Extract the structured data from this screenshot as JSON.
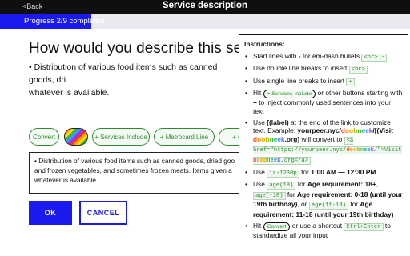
{
  "header": {
    "back_label": "<Back",
    "title": "Service description"
  },
  "progress": {
    "label": "Progress 2/9 completed",
    "fraction": 0.222
  },
  "question": {
    "title": "How would you describe this servi",
    "preview_line1": "• Distribution of various food items such as canned goods, dri",
    "preview_line2": "whatever is available."
  },
  "chips": {
    "convert": "Convert",
    "services": "+ Services Include",
    "metrocard": "+ Metrocard Line",
    "criminal": "+ Crimi"
  },
  "editor": {
    "line1": "• Distribution of various food items such as canned goods, dried goo",
    "line2": "and frozen vegetables, and sometimes frozen meats. Items given a",
    "line3": "whatever is available."
  },
  "buttons": {
    "ok": "OK",
    "cancel": "CANCEL"
  },
  "instructions": {
    "heading": "Instructions:",
    "item1_pre": "Start lines with ",
    "item1_dash": "-",
    "item1_mid": " for em-dash bullets ",
    "item1_code": "<br> -",
    "item2_pre": "Use double line breaks to insert ",
    "item2_code": "<br>",
    "item3_pre": "Use single line breaks to insert ",
    "item3_code": "•",
    "item4_pre": "Hit ",
    "item4_chip": "+ Services Include",
    "item4_mid": " or other buttons starting with ",
    "item4_plus": "+",
    "item4_post": " to inject commonly used sentences into your text",
    "item5_pre": "Use ",
    "item5_label": "[(label)",
    "item5_mid1": " at the end of the link to customize text. Example: ",
    "item5_ex1": "yourpeer.nyc/",
    "item5_ex2": "doobneek",
    "item5_ex3": "/[(Visit ",
    "item5_ex4": "doobneek",
    "item5_ex5": ".org)",
    "item5_mid2": " will convert to ",
    "item5_code1": "<a href=\"https://yourpeer.nyc/",
    "item5_code2": "doobneek",
    "item5_code3": "/\">Visit ",
    "item5_code4": "doobneek",
    "item5_code5": ".org</a>",
    "item6_pre": "Use ",
    "item6_code": "1a-1230p",
    "item6_mid": " for ",
    "item6_bold": "1:00 AM — 12:30 PM",
    "item7_pre": "Use ",
    "item7_code1": "age(18)",
    "item7_mid1": " for ",
    "item7_bold1": "Age requirement: 18+",
    "item7_mid2": ", ",
    "item7_code2": "age(-18)",
    "item7_mid3": " for ",
    "item7_bold2": "Age requirement: 0-18 (until your 19th birthday)",
    "item7_mid4": ", or ",
    "item7_code3": "age(11-18)",
    "item7_mid5": " for ",
    "item7_bold3": "Age requirement: 11-18 (until your 19th birthday)",
    "item8_pre": "Hit ",
    "item8_chip": "Convert",
    "item8_mid": " or use a shortcut ",
    "item8_code": "Ctrl+Enter",
    "item8_post": " to standardize all your input"
  },
  "colors": {
    "accent": "#1a1aee",
    "chip_green": "#2e8b2e",
    "topbar": "#0f0f0f"
  }
}
